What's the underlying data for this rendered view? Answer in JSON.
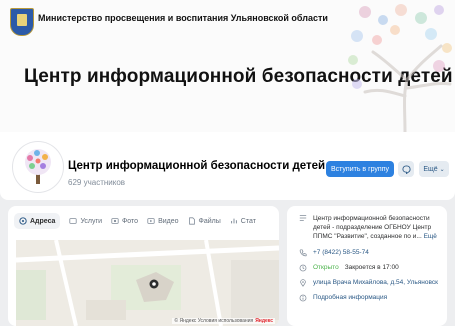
{
  "cover": {
    "ministry": "Министерство просвещения и воспитания Ульяновской области",
    "title": "Центр информационной безопасности детей"
  },
  "profile": {
    "name": "Центр информационной безопасности детей",
    "members": "629 участников",
    "join_label": "Вступить в группу",
    "more_label": "Ещё"
  },
  "tabs": [
    {
      "label": "Адреса",
      "icon": "location-icon"
    },
    {
      "label": "Услуги",
      "icon": "services-icon"
    },
    {
      "label": "Фото",
      "icon": "photo-icon"
    },
    {
      "label": "Видео",
      "icon": "video-icon"
    },
    {
      "label": "Файлы",
      "icon": "file-icon"
    },
    {
      "label": "Стат",
      "icon": "stats-icon"
    }
  ],
  "map": {
    "attribution": "© Яндекс Условия использования",
    "brand": "Яндекс"
  },
  "info": {
    "description_line1": "Центр информационной безопасности",
    "description_line2": "детей - подразделение ОГБНОУ Центр",
    "description_line3": "ППМС \"Развитие\", созданное по и...",
    "description_more": "Ещё",
    "phone": "+7 (8422) 58-55-74",
    "status_open": "Открыто",
    "status_close": "Закроется в 17:00",
    "address_line1": "улица Врача Михайлова, д.54, Ульяновск",
    "details_link": "Подробная информация"
  }
}
